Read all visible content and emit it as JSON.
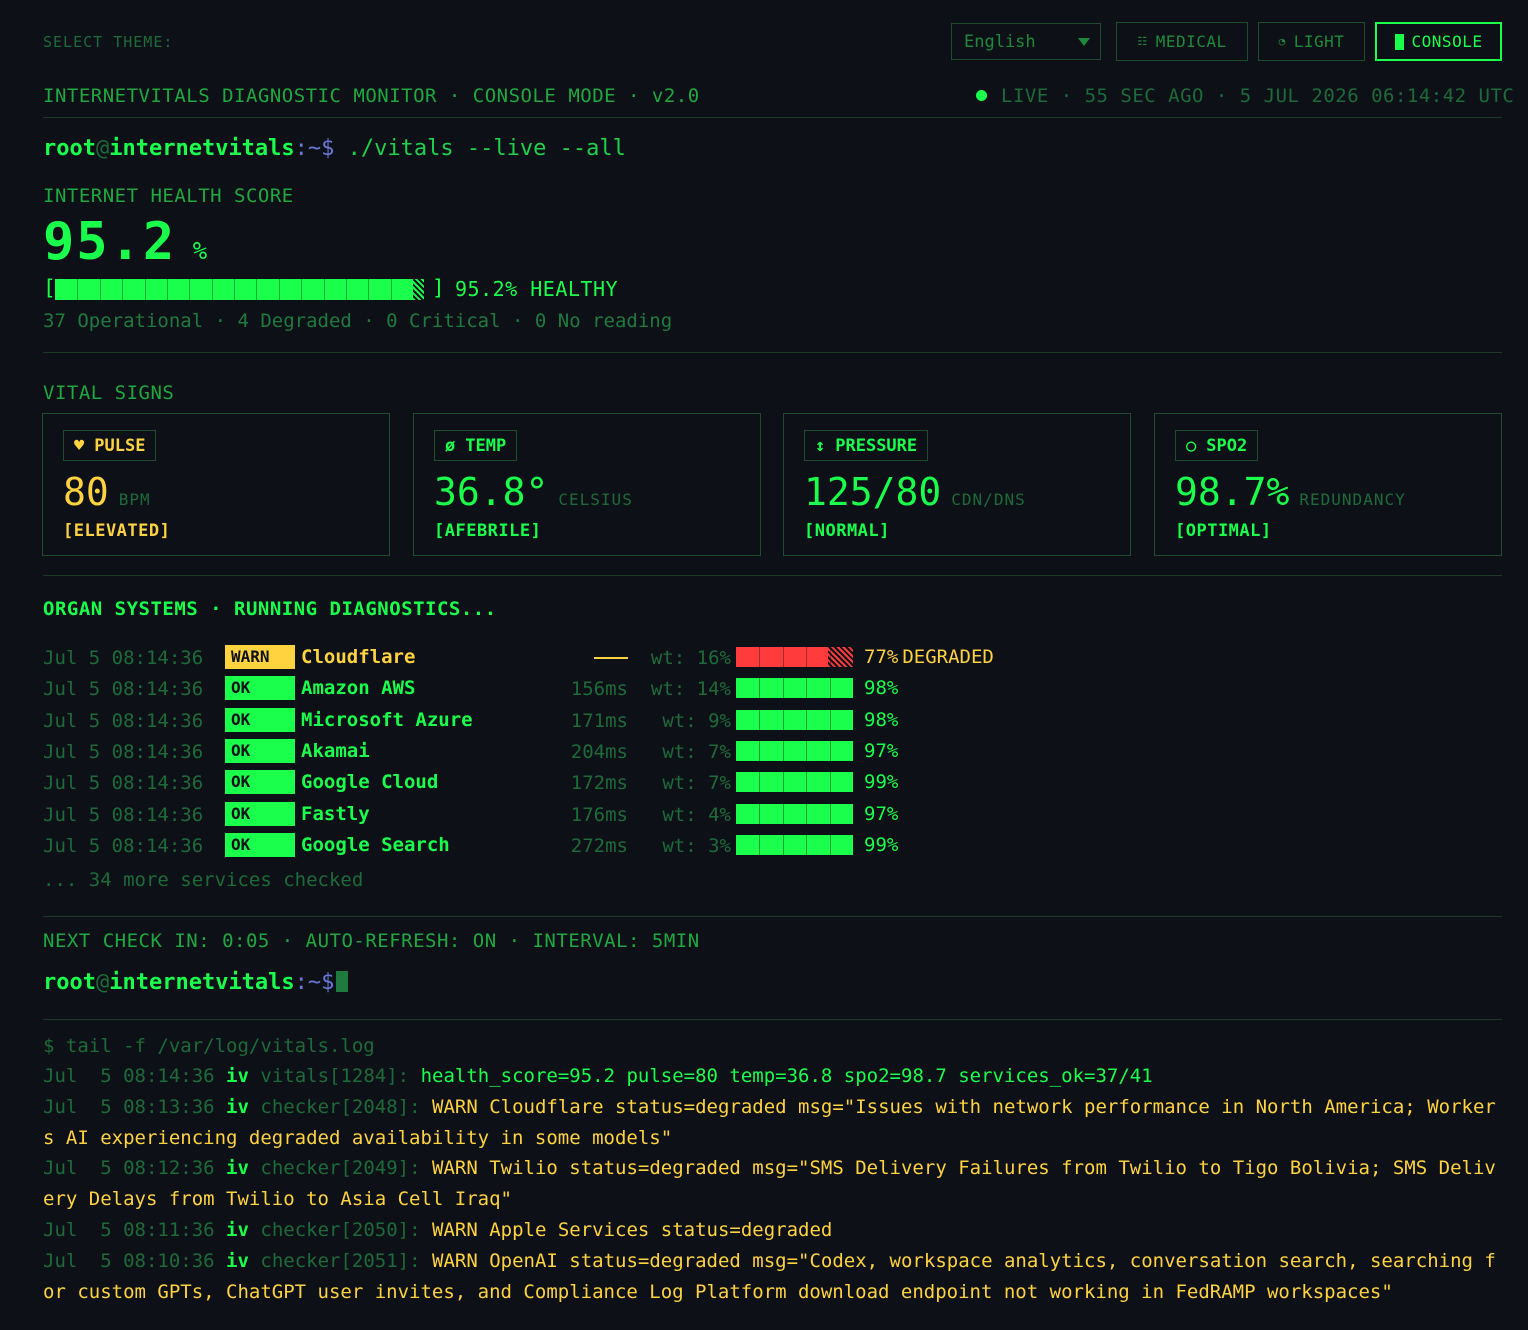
{
  "top": {
    "theme_label": "SELECT THEME:",
    "language": "English",
    "themes": [
      {
        "label": "MEDICAL",
        "icon": "grid-icon",
        "active": false
      },
      {
        "label": "LIGHT",
        "icon": "half-circle-icon",
        "active": false
      },
      {
        "label": "CONSOLE",
        "icon": "cursor-block-icon",
        "active": true
      }
    ]
  },
  "header": {
    "title": "INTERNETVITALS DIAGNOSTIC MONITOR · CONSOLE MODE · v2.0",
    "live": "LIVE · 55 SEC AGO · 5 JUL 2026 06:14:42 UTC"
  },
  "prompt": {
    "user": "root",
    "at": "@",
    "host": "internetvitals",
    "path": ":~$",
    "command": " ./vitals --live --all"
  },
  "health": {
    "title": "INTERNET HEALTH SCORE",
    "score": "95.2",
    "unit": "%",
    "bar_fraction": 0.952,
    "bar_label": "95.2% HEALTHY",
    "summary": "37 Operational · 4 Degraded · 0 Critical · 0 No reading"
  },
  "vitals": {
    "title": "VITAL SIGNS",
    "cards": [
      {
        "tag": "PULSE",
        "icon": "heart-icon",
        "value": "80",
        "unit": "BPM",
        "status": "[ELEVATED]",
        "color": "#ffd23f"
      },
      {
        "tag": "TEMP",
        "icon": "empty-set-icon",
        "value": "36.8°",
        "unit": "CELSIUS",
        "status": "[AFEBRILE]",
        "color": "#19ff4b"
      },
      {
        "tag": "PRESSURE",
        "icon": "up-down-arrow-icon",
        "value": "125/80",
        "unit": "CDN/DNS",
        "status": "[NORMAL]",
        "color": "#19ff4b"
      },
      {
        "tag": "SPO2",
        "icon": "circle-icon",
        "value": "98.7%",
        "unit": "REDUNDANCY",
        "status": "[OPTIMAL]",
        "color": "#19ff4b"
      }
    ]
  },
  "organs": {
    "title": "ORGAN SYSTEMS · RUNNING DIAGNOSTICS...",
    "rows": [
      {
        "ts": "Jul 5 08:14:36",
        "badge": "WARN",
        "name": "Cloudflare",
        "latency": "",
        "weight": "wt: 16%",
        "pct": "77%",
        "value": 0.77,
        "extra": "DEGRADED"
      },
      {
        "ts": "Jul 5 08:14:36",
        "badge": "OK",
        "name": "Amazon AWS",
        "latency": "156ms",
        "weight": "wt: 14%",
        "pct": "98%",
        "value": 0.98,
        "extra": ""
      },
      {
        "ts": "Jul 5 08:14:36",
        "badge": "OK",
        "name": "Microsoft Azure",
        "latency": "171ms",
        "weight": "wt: 9%",
        "pct": "98%",
        "value": 0.98,
        "extra": ""
      },
      {
        "ts": "Jul 5 08:14:36",
        "badge": "OK",
        "name": "Akamai",
        "latency": "204ms",
        "weight": "wt: 7%",
        "pct": "97%",
        "value": 0.97,
        "extra": ""
      },
      {
        "ts": "Jul 5 08:14:36",
        "badge": "OK",
        "name": "Google Cloud",
        "latency": "172ms",
        "weight": "wt: 7%",
        "pct": "99%",
        "value": 0.99,
        "extra": ""
      },
      {
        "ts": "Jul 5 08:14:36",
        "badge": "OK",
        "name": "Fastly",
        "latency": "176ms",
        "weight": "wt: 4%",
        "pct": "97%",
        "value": 0.97,
        "extra": ""
      },
      {
        "ts": "Jul 5 08:14:36",
        "badge": "OK",
        "name": "Google Search",
        "latency": "272ms",
        "weight": "wt: 3%",
        "pct": "99%",
        "value": 0.99,
        "extra": ""
      }
    ],
    "more": "... 34 more services checked"
  },
  "footer": {
    "next_check": "NEXT CHECK IN: 0:05 · AUTO-REFRESH: ON · INTERVAL: 5MIN"
  },
  "log": {
    "command": "$ tail -f /var/log/vitals.log",
    "lines": [
      {
        "date": "Jul  5 08:14:36",
        "app": "iv",
        "proc": "vitals[1284]:",
        "msg": "health_score=95.2 pulse=80 temp=36.8 spo2=98.7 services_ok=37/41",
        "level": "ok"
      },
      {
        "date": "Jul  5 08:13:36",
        "app": "iv",
        "proc": "checker[2048]:",
        "msg": "WARN Cloudflare status=degraded msg=\"Issues with network performance in North America; Workers AI experiencing degraded availability in some models\"",
        "level": "warn"
      },
      {
        "date": "Jul  5 08:12:36",
        "app": "iv",
        "proc": "checker[2049]:",
        "msg": "WARN Twilio status=degraded msg=\"SMS Delivery Failures from Twilio to Tigo Bolivia; SMS Delivery Delays from Twilio to Asia Cell Iraq\"",
        "level": "warn"
      },
      {
        "date": "Jul  5 08:11:36",
        "app": "iv",
        "proc": "checker[2050]:",
        "msg": "WARN Apple Services status=degraded",
        "level": "warn"
      },
      {
        "date": "Jul  5 08:10:36",
        "app": "iv",
        "proc": "checker[2051]:",
        "msg": "WARN OpenAI status=degraded msg=\"Codex, workspace analytics, conversation search, searching for custom GPTs, ChatGPT user invites, and Compliance Log Platform download endpoint not working in FedRAMP workspaces\"",
        "level": "warn"
      }
    ]
  },
  "colors": {
    "background": "#0d1117",
    "green": "#19ff4b",
    "dim_green": "#1d6b38",
    "warn": "#ffd23f",
    "error": "#ff3b3b"
  }
}
